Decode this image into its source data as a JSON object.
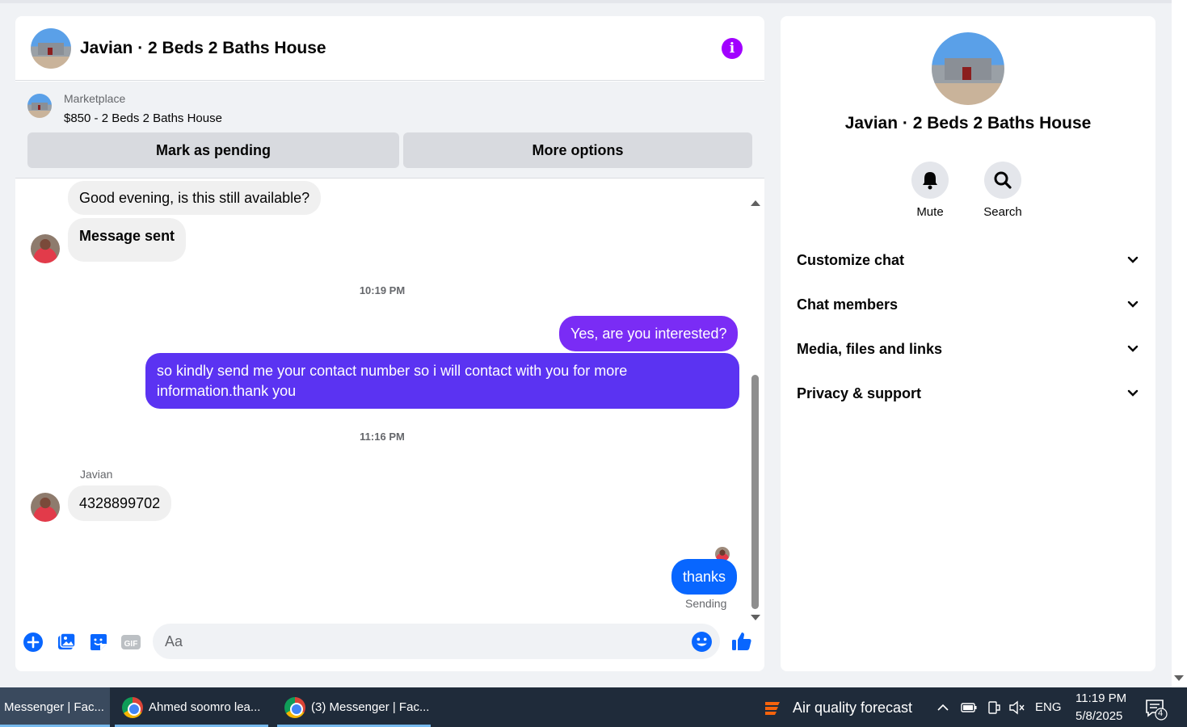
{
  "chat": {
    "title": "Javian · 2 Beds 2 Baths House",
    "listing": {
      "source": "Marketplace",
      "price_title": "$850 - 2 Beds 2 Baths House",
      "mark_pending_label": "Mark as pending",
      "more_options_label": "More options"
    },
    "messages": {
      "m1": "Good evening, is this still available?",
      "m2": "Message sent",
      "ts1": "10:19 PM",
      "m3": "Yes, are you interested?",
      "m4_line1": "so kindly send me your contact number so i will contact with you for more",
      "m4_line2": "information.thank you",
      "ts2": "11:16 PM",
      "sender": "Javian",
      "m5": "4328899702",
      "m6": "thanks",
      "status": "Sending"
    },
    "composer": {
      "placeholder": "Aa"
    }
  },
  "details": {
    "title": "Javian · 2 Beds 2 Baths House",
    "mute_label": "Mute",
    "search_label": "Search",
    "sections": [
      "Customize chat",
      "Chat members",
      "Media, files and links",
      "Privacy & support"
    ]
  },
  "taskbar": {
    "tasks": [
      "Messenger | Fac...",
      "Ahmed soomro lea...",
      "(3) Messenger | Fac..."
    ],
    "weather": "Air quality forecast",
    "lang": "ENG",
    "time": "11:19 PM",
    "date": "5/8/2025",
    "notifications": "4"
  },
  "colors": {
    "accent_purple": "#a100ff",
    "bubble_purple": "#7a2cf5",
    "bubble_indigo": "#5b33f2",
    "bubble_blue": "#0866ff"
  }
}
